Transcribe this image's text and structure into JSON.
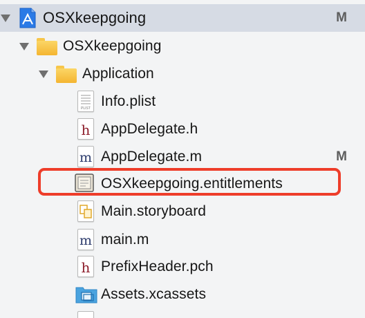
{
  "navigator": {
    "project": {
      "name": "OSXkeepgoing",
      "status": "M",
      "icon": "xcode-project-icon"
    },
    "group_main": {
      "name": "OSXkeepgoing",
      "icon": "folder-icon"
    },
    "group_application": {
      "name": "Application",
      "icon": "folder-icon"
    },
    "files": [
      {
        "name": "Info.plist",
        "icon": "plist-file-icon",
        "glyph": "PLIST",
        "status": ""
      },
      {
        "name": "AppDelegate.h",
        "icon": "header-file-icon",
        "glyph": "h",
        "status": ""
      },
      {
        "name": "AppDelegate.m",
        "icon": "objc-file-icon",
        "glyph": "m",
        "status": "M"
      },
      {
        "name": "OSXkeepgoing.entitlements",
        "icon": "entitlements-file-icon",
        "glyph": "",
        "status": ""
      },
      {
        "name": "Main.storyboard",
        "icon": "storyboard-file-icon",
        "glyph": "",
        "status": ""
      },
      {
        "name": "main.m",
        "icon": "objc-file-icon",
        "glyph": "m",
        "status": ""
      },
      {
        "name": "PrefixHeader.pch",
        "icon": "header-file-icon",
        "glyph": "h",
        "status": ""
      },
      {
        "name": "Assets.xcassets",
        "icon": "asset-catalog-icon",
        "glyph": "",
        "status": ""
      }
    ]
  },
  "colors": {
    "selection": "#d6dbe4",
    "highlight_border": "#ee3d2a",
    "folder": "#f4b531",
    "project_icon": "#1f6fe0",
    "file_glyph": "#8c1c2a"
  }
}
